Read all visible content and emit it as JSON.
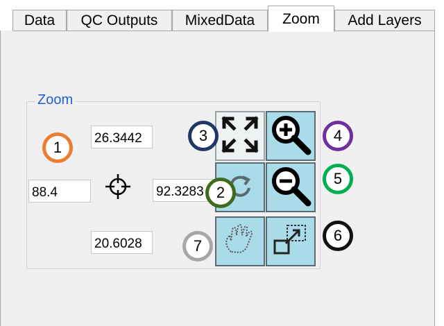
{
  "tabs": [
    {
      "label": "Data",
      "active": false
    },
    {
      "label": "QC Outputs",
      "active": false
    },
    {
      "label": "MixedData",
      "active": false
    },
    {
      "label": "Zoom",
      "active": true
    },
    {
      "label": "Add Layers",
      "active": false
    }
  ],
  "zoom_group": {
    "title": "Zoom",
    "top_value": "26.3442",
    "left_value": "88.4",
    "right_value": "92.3283",
    "bottom_value": "20.6028"
  },
  "tools": {
    "full_extent": {
      "icon": "full-extent-icon"
    },
    "zoom_in": {
      "icon": "zoom-in-icon"
    },
    "refresh": {
      "icon": "refresh-icon"
    },
    "zoom_out": {
      "icon": "zoom-out-icon"
    },
    "pan": {
      "icon": "pan-hand-icon"
    },
    "zoom_box": {
      "icon": "zoom-box-icon"
    }
  },
  "markers": [
    {
      "label": "1",
      "color": "#ed7d31"
    },
    {
      "label": "2",
      "color": "#3f6b1f"
    },
    {
      "label": "3",
      "color": "#1f3864"
    },
    {
      "label": "4",
      "color": "#7030a0"
    },
    {
      "label": "5",
      "color": "#00b050"
    },
    {
      "label": "6",
      "color": "#111111"
    },
    {
      "label": "7",
      "color": "#a6a6a6"
    }
  ],
  "colors": {
    "tool_button_bg": "#a9dbe8",
    "group_title": "#1c5fd8"
  }
}
